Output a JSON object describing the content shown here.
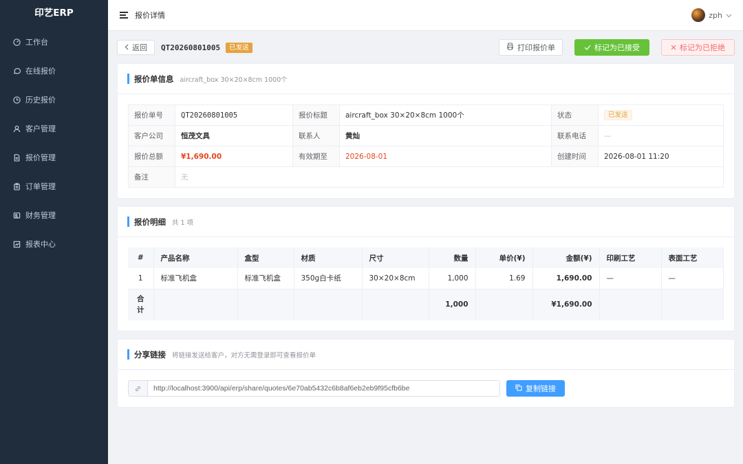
{
  "app": {
    "title": "印艺ERP"
  },
  "sidebar": {
    "items": [
      {
        "label": "工作台",
        "icon": "dashboard-icon"
      },
      {
        "label": "在线报价",
        "icon": "chat-icon"
      },
      {
        "label": "历史报价",
        "icon": "clock-icon"
      },
      {
        "label": "客户管理",
        "icon": "user-icon"
      },
      {
        "label": "报价管理",
        "icon": "document-icon"
      },
      {
        "label": "订单管理",
        "icon": "clipboard-icon"
      },
      {
        "label": "财务管理",
        "icon": "wallet-icon"
      },
      {
        "label": "报表中心",
        "icon": "chart-icon"
      }
    ]
  },
  "topbar": {
    "breadcrumb": "报价详情",
    "username": "zph"
  },
  "header": {
    "back_label": "返回",
    "quote_no": "QT20260801005",
    "status_tag": "已发送",
    "print_label": "打印报价单",
    "accept_label": "标记为已接受",
    "reject_label": "标记为已拒绝"
  },
  "info": {
    "title": "报价单信息",
    "subtitle": "aircraft_box 30×20×8cm 1000个",
    "labels": {
      "no": "报价单号",
      "subject": "报价标题",
      "status": "状态",
      "company": "客户公司",
      "contact": "联系人",
      "phone": "联系电话",
      "total": "报价总额",
      "valid": "有效期至",
      "created": "创建时间",
      "remark": "备注"
    },
    "values": {
      "no": "QT20260801005",
      "subject": "aircraft_box 30×20×8cm 1000个",
      "status": "已发送",
      "company": "恒茂文具",
      "contact": "黄灿",
      "phone": "—",
      "total": "¥1,690.00",
      "valid": "2026-08-01",
      "created": "2026-08-01 11:20",
      "remark": "无"
    }
  },
  "details": {
    "title": "报价明细",
    "subtitle": "共 1 项",
    "columns": [
      "#",
      "产品名称",
      "盒型",
      "材质",
      "尺寸",
      "数量",
      "单价(¥)",
      "金额(¥)",
      "印刷工艺",
      "表面工艺"
    ],
    "rows": [
      [
        "1",
        "标准飞机盒",
        "标准飞机盒",
        "350g白卡纸",
        "30×20×8cm",
        "1,000",
        "1.69",
        "1,690.00",
        "—",
        "—"
      ]
    ],
    "summary": {
      "label": "合计",
      "qty": "1,000",
      "amount": "¥1,690.00"
    }
  },
  "share": {
    "title": "分享链接",
    "subtitle": "将链接发送给客户，对方无需登录即可查看报价单",
    "url": "http://localhost:3900/api/erp/share/quotes/6e70ab5432c6b8af6eb2eb9f95cfb6be",
    "copy_label": "复制链接"
  }
}
